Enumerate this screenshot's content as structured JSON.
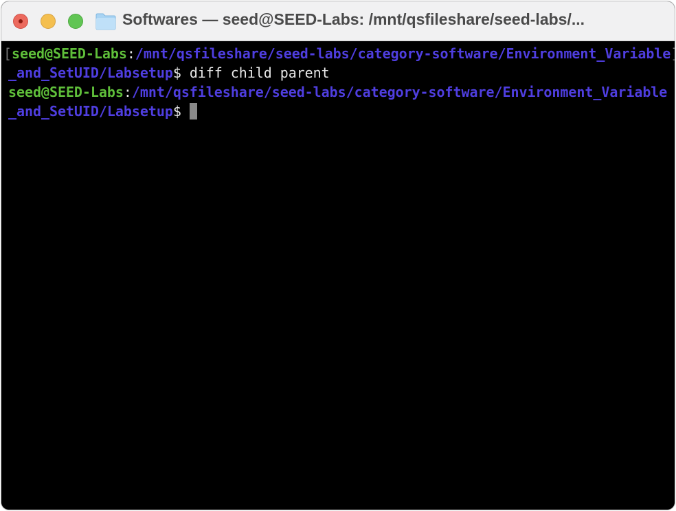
{
  "window": {
    "title": "Softwares — seed@SEED-Labs: /mnt/qsfileshare/seed-labs/...",
    "folder_icon": "folder-icon"
  },
  "terminal": {
    "lines": [
      {
        "user": "seed@SEED-Labs",
        "sep": ":",
        "path": "/mnt/qsfileshare/seed-labs/category-software/Environment_Variable",
        "cont": "_and_SetUID/Labsetup",
        "prompt": "$ ",
        "command": "diff child parent"
      },
      {
        "user": "seed@SEED-Labs",
        "sep": ":",
        "path": "/mnt/qsfileshare/seed-labs/category-software/Environment_Variable",
        "cont": "_and_SetUID/Labsetup",
        "prompt": "$",
        "command": ""
      }
    ],
    "mark_open": "[",
    "mark_close": "]",
    "colors": {
      "user": "#5fbf3a",
      "path": "#4f3ee0",
      "text": "#e8e8e8",
      "background": "#000000"
    }
  }
}
